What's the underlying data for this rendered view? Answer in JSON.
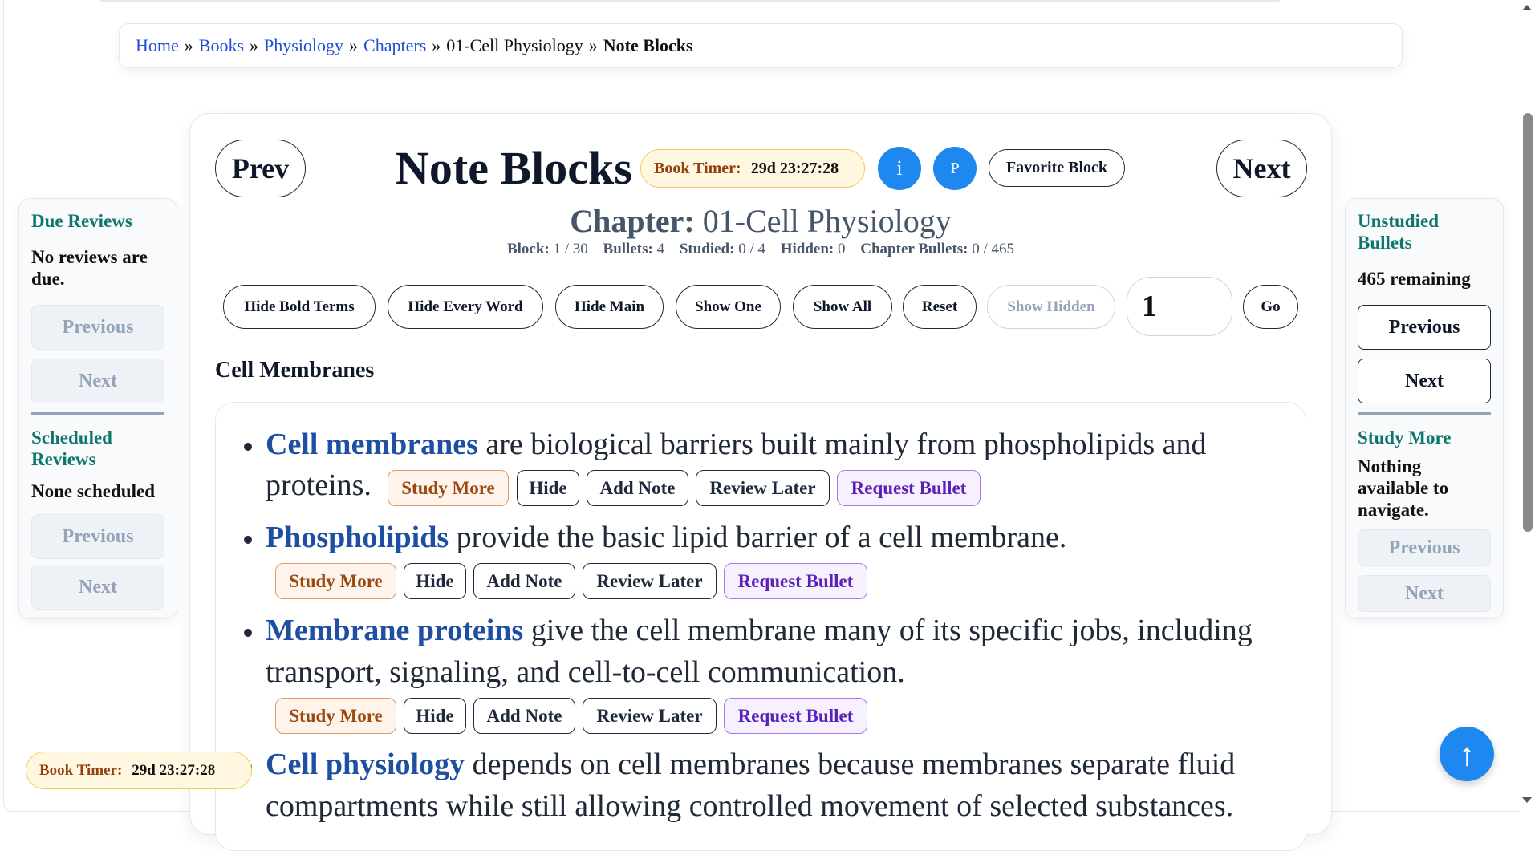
{
  "breadcrumb": {
    "home": "Home",
    "books": "Books",
    "physiology": "Physiology",
    "chapters": "Chapters",
    "chapter": "01-Cell Physiology",
    "current": "Note Blocks",
    "sep": "»"
  },
  "header": {
    "prev": "Prev",
    "next": "Next",
    "title": "Note Blocks",
    "timer_label": "Book Timer:",
    "timer_value": "29d 23:27:28",
    "info_btn": "i",
    "p_btn": "P",
    "favorite": "Favorite Block"
  },
  "chapter": {
    "label": "Chapter:",
    "name": "01-Cell Physiology"
  },
  "stats": {
    "block_label": "Block:",
    "block_value": "1 / 30",
    "bullets_label": "Bullets:",
    "bullets_value": "4",
    "studied_label": "Studied:",
    "studied_value": "0 / 4",
    "hidden_label": "Hidden:",
    "hidden_value": "0",
    "chapter_bullets_label": "Chapter Bullets:",
    "chapter_bullets_value": "0 / 465"
  },
  "controls": {
    "hide_bold": "Hide Bold Terms",
    "hide_every": "Hide Every Word",
    "hide_main": "Hide Main",
    "show_one": "Show One",
    "show_all": "Show All",
    "reset": "Reset",
    "show_hidden": "Show Hidden",
    "go_value": "1",
    "go": "Go"
  },
  "section_title": "Cell Membranes",
  "actions": {
    "study_more": "Study More",
    "hide": "Hide",
    "add_note": "Add Note",
    "review_later": "Review Later",
    "request_bullet": "Request Bullet"
  },
  "bullets": [
    {
      "term": "Cell membranes",
      "line1": " are biological barriers built mainly from phospholipids and",
      "line2": "proteins."
    },
    {
      "term": "Phospholipids",
      "line1": " provide the basic lipid barrier of a cell membrane."
    },
    {
      "term": "Membrane proteins",
      "line1": " give the cell membrane many of its specific jobs, including",
      "line2": "transport, signaling, and cell-to-cell communication."
    },
    {
      "term": "Cell physiology",
      "line1": " depends on cell membranes because membranes separate fluid",
      "line2": "compartments while still allowing controlled movement of selected substances."
    }
  ],
  "left_panel": {
    "due_title": "Due Reviews",
    "due_text": "No reviews are due.",
    "scheduled_title": "Scheduled Reviews",
    "scheduled_text": "None scheduled",
    "previous": "Previous",
    "next": "Next"
  },
  "right_panel": {
    "unstudied_title": "Unstudied Bullets",
    "unstudied_text": "465 remaining",
    "study_more_title": "Study More",
    "study_more_text": "Nothing available to navigate.",
    "previous": "Previous",
    "next": "Next"
  },
  "fab": "↑",
  "colors": {
    "accent": "#1e88f0",
    "term": "#1e4fa3",
    "panel_heading": "#0f766e"
  }
}
